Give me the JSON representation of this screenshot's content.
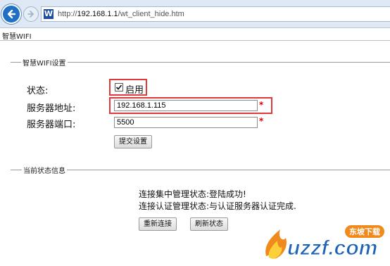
{
  "browser": {
    "url_prefix": "http://",
    "url_host": "192.168.1.1",
    "url_path": "/wt_client_hide.htm",
    "favicon_letter": "W"
  },
  "page": {
    "title": "智慧WIFI"
  },
  "settings": {
    "legend": "智慧WIFI设置",
    "status_label": "状态:",
    "status_checkbox_label": "启用",
    "status_checked": true,
    "server_address_label": "服务器地址:",
    "server_address_value": "192.168.1.115",
    "server_port_label": "服务器端口:",
    "server_port_value": "5500",
    "required_mark": "*",
    "submit_label": "提交设置"
  },
  "current_status": {
    "legend": "当前状态信息",
    "line1": "连接集中管理状态:登陆成功!",
    "line2": "连接认证管理状态:与认证服务器认证完成.",
    "reconnect_label": "重新连接",
    "refresh_label": "刷新状态"
  },
  "watermark": {
    "brand_text": "uzzf.com",
    "badge_text": "东坡下载"
  },
  "colors": {
    "highlight": "#e0383b",
    "required": "#e00000",
    "chrome": "#dfe9f5",
    "back_button": "#1f6fc5"
  }
}
